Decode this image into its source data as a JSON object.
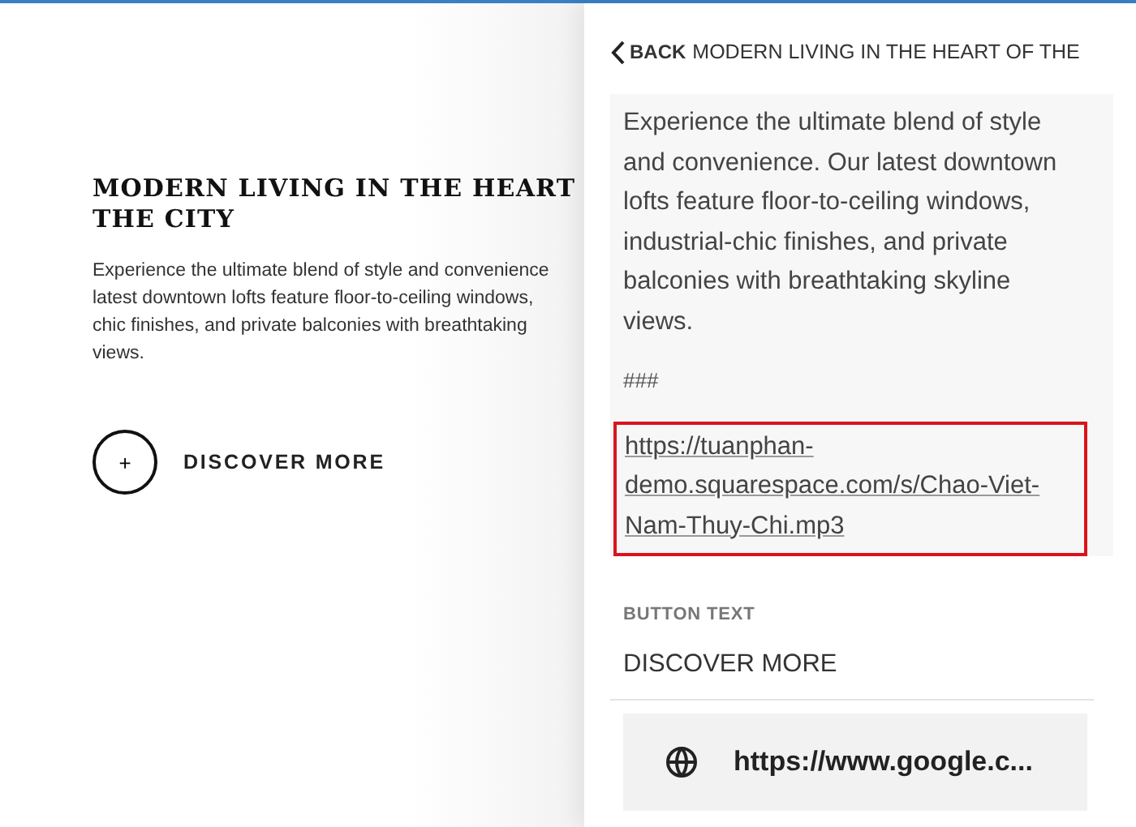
{
  "preview": {
    "heading_lines": [
      "MODERN LIVING IN THE HEART",
      "THE CITY"
    ],
    "body_lines": [
      "Experience the ultimate blend of style and convenience",
      "latest downtown lofts feature floor-to-ceiling windows,",
      "chic finishes, and private balconies with breathtaking",
      "views."
    ],
    "button": {
      "icon": "+",
      "label": "DISCOVER MORE"
    }
  },
  "panel": {
    "back": "BACK",
    "title": "MODERN LIVING IN THE HEART OF THE",
    "description": "Experience the ultimate blend of style and convenience. Our latest downtown lofts feature floor-to-ceiling windows, industrial-chic finishes, and private balconies with breathtaking skyline views.",
    "separator": "###",
    "link": {
      "text": "https://tuanphan-demo.squarespace.com/s/Chao-Viet-Nam-Thuy-Chi.mp3",
      "highlighted": true
    },
    "button_text_label": "BUTTON TEXT",
    "button_text_value": "DISCOVER MORE",
    "url_field": "https://www.google.c..."
  }
}
